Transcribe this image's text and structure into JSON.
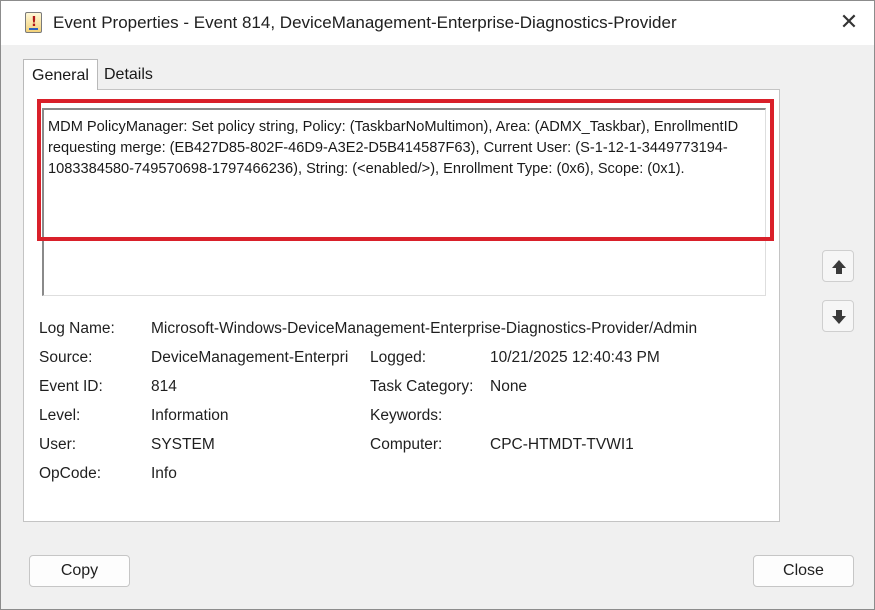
{
  "window": {
    "title": "Event Properties - Event 814, DeviceManagement-Enterprise-Diagnostics-Provider",
    "close_glyph": "✕"
  },
  "tabs": [
    {
      "label": "General",
      "active": true
    },
    {
      "label": "Details",
      "active": false
    }
  ],
  "description": "MDM PolicyManager: Set policy string, Policy: (TaskbarNoMultimon), Area: (ADMX_Taskbar), EnrollmentID requesting merge: (EB427D85-802F-46D9-A3E2-D5B414587F63), Current User: (S-1-12-1-3449773194-1083384580-749570698-1797466236), String: (<enabled/>), Enrollment Type: (0x6), Scope: (0x1).",
  "highlight_color": "#d9202a",
  "fields": {
    "log_name": {
      "label": "Log Name:",
      "value": "Microsoft-Windows-DeviceManagement-Enterprise-Diagnostics-Provider/Admin"
    },
    "source": {
      "label": "Source:",
      "value": "DeviceManagement-Enterpri"
    },
    "logged": {
      "label": "Logged:",
      "value": "10/21/2025 12:40:43 PM"
    },
    "event_id": {
      "label": "Event ID:",
      "value": "814"
    },
    "task_category": {
      "label": "Task Category:",
      "value": "None"
    },
    "level": {
      "label": "Level:",
      "value": "Information"
    },
    "keywords": {
      "label": "Keywords:",
      "value": ""
    },
    "user": {
      "label": "User:",
      "value": "SYSTEM"
    },
    "computer": {
      "label": "Computer:",
      "value": "CPC-HTMDT-TVWI1"
    },
    "opcode": {
      "label": "OpCode:",
      "value": "Info"
    }
  },
  "nav": {
    "up_icon": "arrow-up-icon",
    "down_icon": "arrow-down-icon"
  },
  "buttons": {
    "copy": "Copy",
    "close": "Close"
  }
}
